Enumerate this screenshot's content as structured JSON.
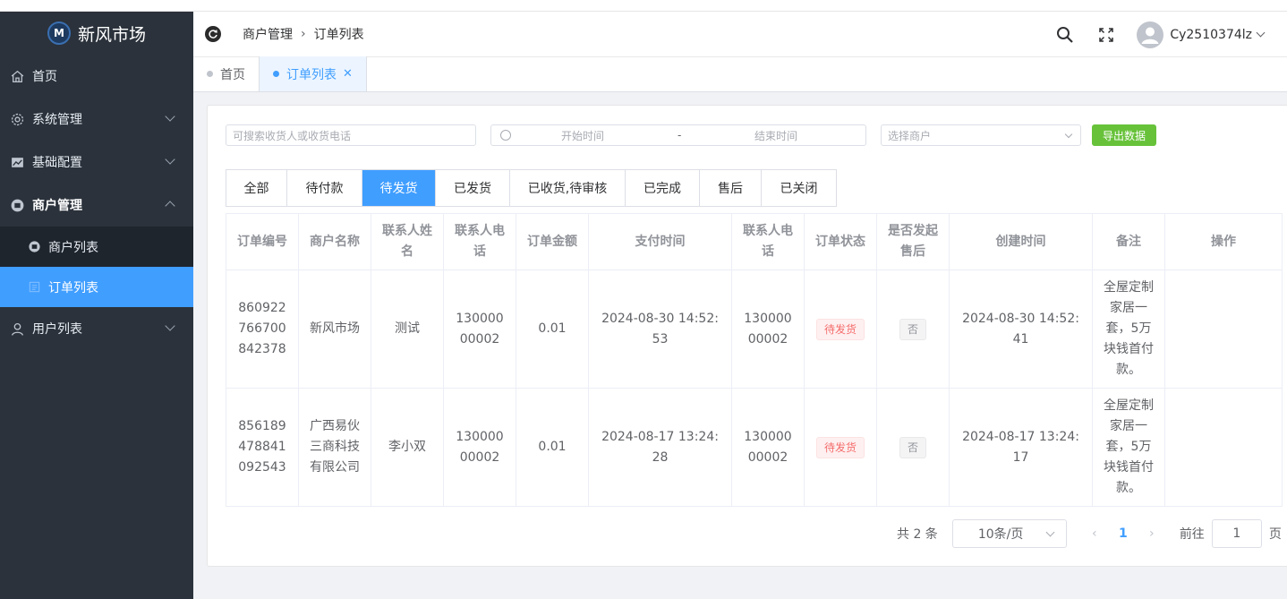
{
  "app": {
    "logo_mark": "M",
    "title": "新风市场"
  },
  "sidebar": {
    "items": [
      {
        "label": "首页",
        "icon": "home-icon"
      },
      {
        "label": "系统管理",
        "icon": "gear-icon"
      },
      {
        "label": "基础配置",
        "icon": "chart-icon"
      },
      {
        "label": "商户管理",
        "icon": "merchant-icon",
        "open": true,
        "children": [
          {
            "label": "商户列表",
            "icon": "merchant-list-icon"
          },
          {
            "label": "订单列表",
            "icon": "order-list-icon",
            "active": true
          }
        ]
      },
      {
        "label": "用户列表",
        "icon": "user-icon"
      }
    ]
  },
  "header": {
    "breadcrumb": [
      "商户管理",
      "订单列表"
    ],
    "username": "Cy2510374lz"
  },
  "tags": [
    {
      "label": "首页",
      "active": false
    },
    {
      "label": "订单列表",
      "active": true,
      "close": "✕"
    }
  ],
  "filters": {
    "search_placeholder": "可搜索收货人或收货电话",
    "start_placeholder": "开始时间",
    "range_separator": "-",
    "end_placeholder": "结束时间",
    "merchant_placeholder": "选择商户",
    "export_label": "导出数据"
  },
  "status_tabs": [
    "全部",
    "待付款",
    "待发货",
    "已发货",
    "已收货,待审核",
    "已完成",
    "售后",
    "已关闭"
  ],
  "active_status_tab": "待发货",
  "table": {
    "headers": [
      "订单编号",
      "商户名称",
      "联系人姓名",
      "联系人电话",
      "订单金额",
      "支付时间",
      "联系人电话",
      "订单状态",
      "是否发起售后",
      "创建时间",
      "备注",
      "操作"
    ],
    "rows": [
      [
        "860922766700842378",
        "新风市场",
        "测试",
        "13000000002",
        "0.01",
        "2024-08-30 14:52:53",
        "13000000002",
        "待发货",
        "否",
        "2024-08-30 14:52:41",
        "全屋定制家居一套，5万块钱首付款。",
        ""
      ],
      [
        "856189478841092543",
        "广西易伙三商科技有限公司",
        "李小双",
        "13000000002",
        "0.01",
        "2024-08-17 13:24:28",
        "13000000002",
        "待发货",
        "否",
        "2024-08-17 13:24:17",
        "全屋定制家居一套，5万块钱首付款。",
        ""
      ]
    ]
  },
  "pagination": {
    "total_text": "共 2 条",
    "page_size": "10条/页",
    "prev": "‹",
    "current_page": "1",
    "next": "›",
    "goto_label": "前往",
    "goto_value": "1",
    "page_unit": "页"
  }
}
